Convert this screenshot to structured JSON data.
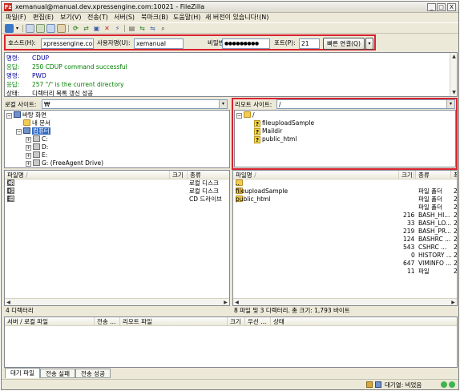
{
  "window": {
    "title": "xemanual@manual.dev.xpressengine.com:10021 - FileZilla",
    "app_icon": "Fz",
    "minimize": "_",
    "maximize": "□",
    "close": "X"
  },
  "menu": [
    "파일(F)",
    "편집(E)",
    "보기(V)",
    "전송(T)",
    "서버(S)",
    "북마크(B)",
    "도움말(H)",
    "새 버전이 있습니다!(N)"
  ],
  "toolbar_icons": [
    "site-manager-icon",
    "dropdown-arrow-icon",
    "message-log-icon",
    "local-tree-icon",
    "remote-tree-icon",
    "queue-icon",
    "refresh-icon",
    "process-queue-icon",
    "cancel-icon",
    "disconnect-icon",
    "reconnect-icon",
    "filter-icon",
    "compare-icon",
    "sync-browse-icon",
    "search-icon"
  ],
  "quickconnect": {
    "host_label": "호스트(H):",
    "host_value": "xpressengine.com",
    "user_label": "사용자명(U):",
    "user_value": "xemanual",
    "pass_label": "비밀번호(W):",
    "pass_value": "●●●●●●●●●",
    "port_label": "포트(P):",
    "port_value": "21",
    "connect_button": "빠른 연결(Q)",
    "dropdown": "▾"
  },
  "log": [
    {
      "label": "명령:",
      "message": "CDUP",
      "color": "#0000a0"
    },
    {
      "label": "응답:",
      "message": "250 CDUP command successful",
      "color": "#008000"
    },
    {
      "label": "명령:",
      "message": "PWD",
      "color": "#0000a0"
    },
    {
      "label": "응답:",
      "message": "257 \"/\" is the current directory",
      "color": "#008000"
    },
    {
      "label": "상태:",
      "message": "디렉터리 목록 갱신 성공",
      "color": "#000000"
    }
  ],
  "local": {
    "site_label": "로컬 사이트:",
    "site_path": "₩",
    "tree": [
      {
        "toggle": "−",
        "icon": "desktop-icon",
        "label": "바탕 화면"
      },
      {
        "toggle": "",
        "icon": "folder-icon",
        "label": "내 문서"
      },
      {
        "toggle": "−",
        "icon": "computer-icon",
        "label": "컴퓨터"
      },
      {
        "toggle": "+",
        "icon": "drive-icon",
        "label": "C:"
      },
      {
        "toggle": "+",
        "icon": "drive-icon",
        "label": "D:"
      },
      {
        "toggle": "+",
        "icon": "drive-icon",
        "label": "E:"
      },
      {
        "toggle": "+",
        "icon": "drive-icon",
        "label": "G: (FreeAgent Drive)"
      }
    ],
    "columns": [
      "파일명",
      "크기",
      "종류"
    ],
    "sort_indicator": "/",
    "files": [
      {
        "name": "C:",
        "size": "",
        "type": "로컬 디스크"
      },
      {
        "name": "D:",
        "size": "",
        "type": "로컬 디스크"
      },
      {
        "name": "E:",
        "size": "",
        "type": "CD 드라이브"
      }
    ],
    "status": "4 디렉터리"
  },
  "remote": {
    "site_label": "리모트 사이트:",
    "site_path": "/",
    "tree": [
      {
        "toggle": "−",
        "icon": "folder-icon",
        "label": "/"
      },
      {
        "toggle": "",
        "icon": "unknown-folder-icon",
        "label": "fileuploadSample"
      },
      {
        "toggle": "",
        "icon": "unknown-folder-icon",
        "label": "Maildir"
      },
      {
        "toggle": "",
        "icon": "unknown-folder-icon",
        "label": "public_html"
      }
    ],
    "columns": [
      "파일명",
      "크기",
      "종류",
      "최"
    ],
    "sort_indicator": "/",
    "files": [
      {
        "name": "..",
        "size": "",
        "type": "",
        "extra": ""
      },
      {
        "name": "fileuploadSample",
        "size": "",
        "type": "파일 폴더",
        "extra": "2"
      },
      {
        "name": "public_html",
        "size": "",
        "type": "파일 폴더",
        "extra": "2"
      },
      {
        "name": "",
        "size": "",
        "type": "파일 폴더",
        "extra": "2"
      },
      {
        "name": "",
        "size": "216",
        "type": "BASH_HI...",
        "extra": "2"
      },
      {
        "name": "",
        "size": "33",
        "type": "BASH_LO...",
        "extra": "2"
      },
      {
        "name": "",
        "size": "219",
        "type": "BASH_PR...",
        "extra": "2"
      },
      {
        "name": "",
        "size": "124",
        "type": "BASHRC ...",
        "extra": "2"
      },
      {
        "name": "",
        "size": "543",
        "type": "CSHRC ...",
        "extra": "2"
      },
      {
        "name": "",
        "size": "0",
        "type": "HISTORY ...",
        "extra": "2"
      },
      {
        "name": "",
        "size": "647",
        "type": "VIMINFO ...",
        "extra": "2"
      },
      {
        "name": "",
        "size": "11",
        "type": "파일",
        "extra": "2"
      }
    ],
    "status": "8 파일 및 3 디렉터리. 총 크기: 1,793 바이트"
  },
  "queue": {
    "columns": [
      "서버 / 로컬 파일",
      "전송 ...",
      "리모트 파일",
      "크기",
      "우선 ...",
      "상태"
    ]
  },
  "tabs": [
    "대기 파일",
    "전송 실패",
    "전송 성공"
  ],
  "statusbar": {
    "queue_text": "대기열: 비었음"
  },
  "colors": {
    "highlight_red": "#d9232f",
    "command_blue": "#0000a0",
    "response_green": "#008000"
  }
}
